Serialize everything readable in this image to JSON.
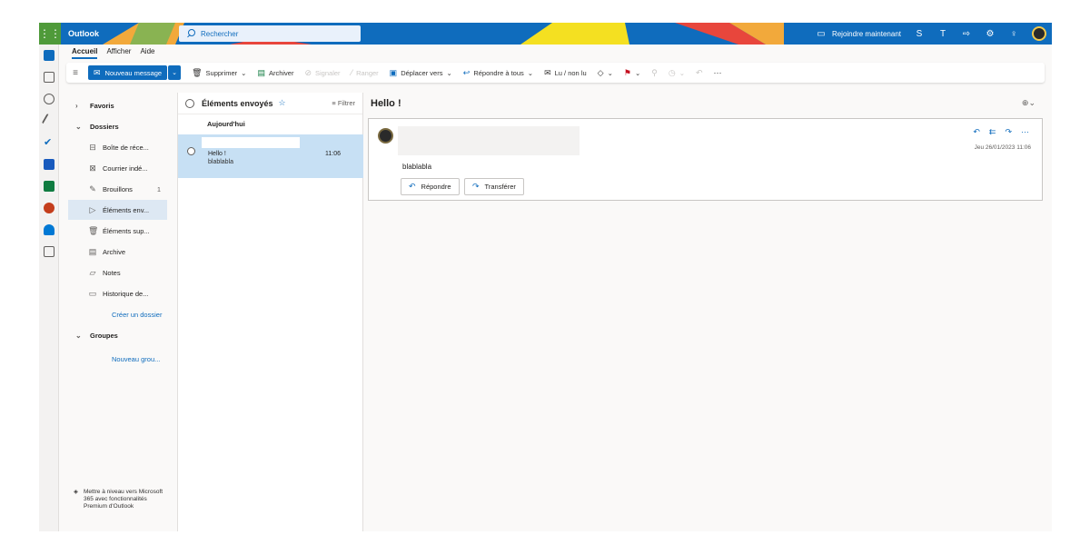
{
  "app": {
    "name": "Outlook"
  },
  "search": {
    "placeholder": "Rechercher"
  },
  "topbar": {
    "join_label": "Rejoindre maintenant"
  },
  "tabs": [
    {
      "label": "Accueil",
      "active": true
    },
    {
      "label": "Afficher"
    },
    {
      "label": "Aide"
    }
  ],
  "ribbon": {
    "new_message": "Nouveau message",
    "delete": "Supprimer",
    "archive": "Archiver",
    "report": "Signaler",
    "sweep": "Ranger",
    "move": "Déplacer vers",
    "reply_all": "Répondre à tous",
    "read_unread": "Lu / non lu"
  },
  "folders": {
    "favorites": "Favoris",
    "folders": "Dossiers",
    "items": [
      {
        "label": "Boîte de réce..."
      },
      {
        "label": "Courrier indé..."
      },
      {
        "label": "Brouillons",
        "count": "1"
      },
      {
        "label": "Éléments env...",
        "selected": true
      },
      {
        "label": "Éléments sup..."
      },
      {
        "label": "Archive"
      },
      {
        "label": "Notes"
      },
      {
        "label": "Historique de..."
      }
    ],
    "create_folder": "Créer un dossier",
    "groups": "Groupes",
    "new_group": "Nouveau grou...",
    "upgrade_text": "Mettre à niveau vers Microsoft 365 avec fonctionnalités Premium d'Outlook"
  },
  "list": {
    "title": "Éléments envoyés",
    "filter": "Filtrer",
    "group_header": "Aujourd'hui",
    "message": {
      "subject": "Hello !",
      "preview": "blablabla",
      "time": "11:06"
    }
  },
  "reading": {
    "subject": "Hello !",
    "body": "blablabla",
    "date": "Jeu 26/01/2023 11:06",
    "reply": "Répondre",
    "forward": "Transférer"
  },
  "colors": {
    "accent": "#0f6cbd",
    "selected_row": "#c7e0f4",
    "selected_folder": "#dde8f3"
  }
}
